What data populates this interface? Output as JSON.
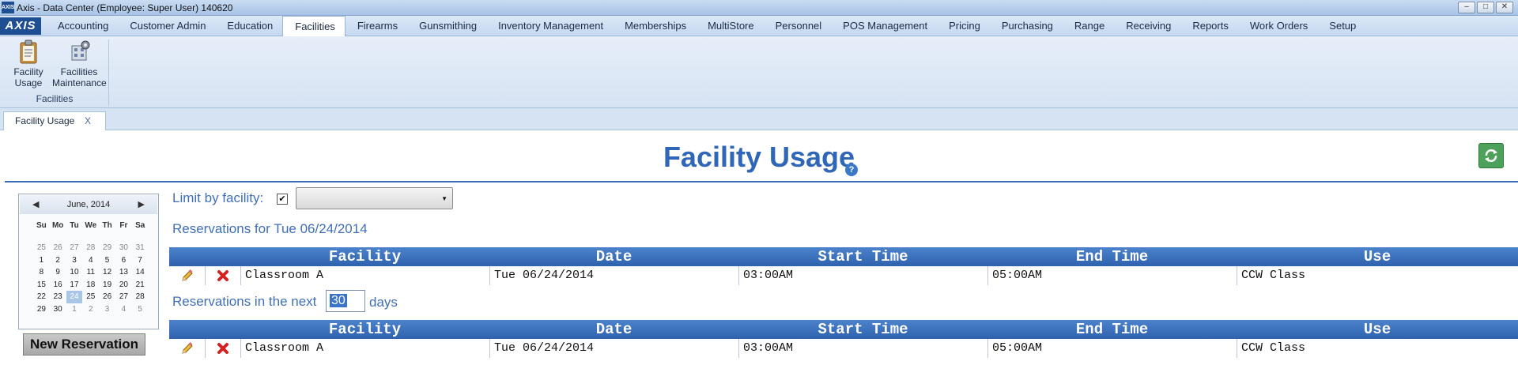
{
  "window": {
    "title": "Axis - Data Center  (Employee: Super User) 140620",
    "app_icon_text": "AXIS",
    "minimize": "–",
    "maximize": "□",
    "close": "✕"
  },
  "menubar": {
    "logo": "AXIS",
    "items": [
      {
        "label": "Accounting"
      },
      {
        "label": "Customer Admin"
      },
      {
        "label": "Education"
      },
      {
        "label": "Facilities",
        "active": true
      },
      {
        "label": "Firearms"
      },
      {
        "label": "Gunsmithing"
      },
      {
        "label": "Inventory Management"
      },
      {
        "label": "Memberships"
      },
      {
        "label": "MultiStore"
      },
      {
        "label": "Personnel"
      },
      {
        "label": "POS Management"
      },
      {
        "label": "Pricing"
      },
      {
        "label": "Purchasing"
      },
      {
        "label": "Range"
      },
      {
        "label": "Receiving"
      },
      {
        "label": "Reports"
      },
      {
        "label": "Work Orders"
      },
      {
        "label": "Setup"
      }
    ]
  },
  "ribbon": {
    "group_label": "Facilities",
    "buttons": [
      {
        "line1": "Facility",
        "line2": "Usage",
        "icon": "clipboard-icon"
      },
      {
        "line1": "Facilities",
        "line2": "Maintenance",
        "icon": "maintenance-icon"
      }
    ]
  },
  "doctab": {
    "label": "Facility Usage",
    "close": "X"
  },
  "page": {
    "title": "Facility Usage",
    "help": "?",
    "refresh_icon": "refresh-icon"
  },
  "calendar": {
    "month": "June, 2014",
    "prev": "◀",
    "next": "▶",
    "days_of_week": [
      "Su",
      "Mo",
      "Tu",
      "We",
      "Th",
      "Fr",
      "Sa"
    ],
    "weeks": [
      [
        {
          "d": "25",
          "o": true
        },
        {
          "d": "26",
          "o": true
        },
        {
          "d": "27",
          "o": true
        },
        {
          "d": "28",
          "o": true
        },
        {
          "d": "29",
          "o": true
        },
        {
          "d": "30",
          "o": true
        },
        {
          "d": "31",
          "o": true
        }
      ],
      [
        {
          "d": "1"
        },
        {
          "d": "2"
        },
        {
          "d": "3"
        },
        {
          "d": "4"
        },
        {
          "d": "5"
        },
        {
          "d": "6"
        },
        {
          "d": "7"
        }
      ],
      [
        {
          "d": "8"
        },
        {
          "d": "9"
        },
        {
          "d": "10"
        },
        {
          "d": "11"
        },
        {
          "d": "12"
        },
        {
          "d": "13"
        },
        {
          "d": "14"
        }
      ],
      [
        {
          "d": "15"
        },
        {
          "d": "16"
        },
        {
          "d": "17"
        },
        {
          "d": "18"
        },
        {
          "d": "19"
        },
        {
          "d": "20"
        },
        {
          "d": "21"
        }
      ],
      [
        {
          "d": "22"
        },
        {
          "d": "23"
        },
        {
          "d": "24",
          "s": true
        },
        {
          "d": "25"
        },
        {
          "d": "26"
        },
        {
          "d": "27"
        },
        {
          "d": "28"
        }
      ],
      [
        {
          "d": "29"
        },
        {
          "d": "30"
        },
        {
          "d": "1",
          "o": true
        },
        {
          "d": "2",
          "o": true
        },
        {
          "d": "3",
          "o": true
        },
        {
          "d": "4",
          "o": true
        },
        {
          "d": "5",
          "o": true
        }
      ]
    ],
    "new_reservation": "New Reservation"
  },
  "filters": {
    "limit_label": "Limit by facility:",
    "limit_checked": "✔",
    "facility_selected": ""
  },
  "reservations_today": {
    "label": "Reservations for Tue 06/24/2014",
    "columns": [
      "Facility",
      "Date",
      "Start Time",
      "End Time",
      "Use"
    ],
    "rows": [
      {
        "facility": "Classroom A",
        "date": "Tue 06/24/2014",
        "start": "03:00AM",
        "end": "05:00AM",
        "use": "CCW Class"
      }
    ]
  },
  "reservations_next": {
    "label": "Reservations in the next",
    "days": "30",
    "days_label": "days",
    "columns": [
      "Facility",
      "Date",
      "Start Time",
      "End Time",
      "Use"
    ],
    "rows": [
      {
        "facility": "Classroom A",
        "date": "Tue 06/24/2014",
        "start": "03:00AM",
        "end": "05:00AM",
        "use": "CCW Class"
      }
    ]
  },
  "colors": {
    "accent": "#3066b8",
    "header_blue": "#2f62ae",
    "refresh_green": "#4da15a"
  }
}
